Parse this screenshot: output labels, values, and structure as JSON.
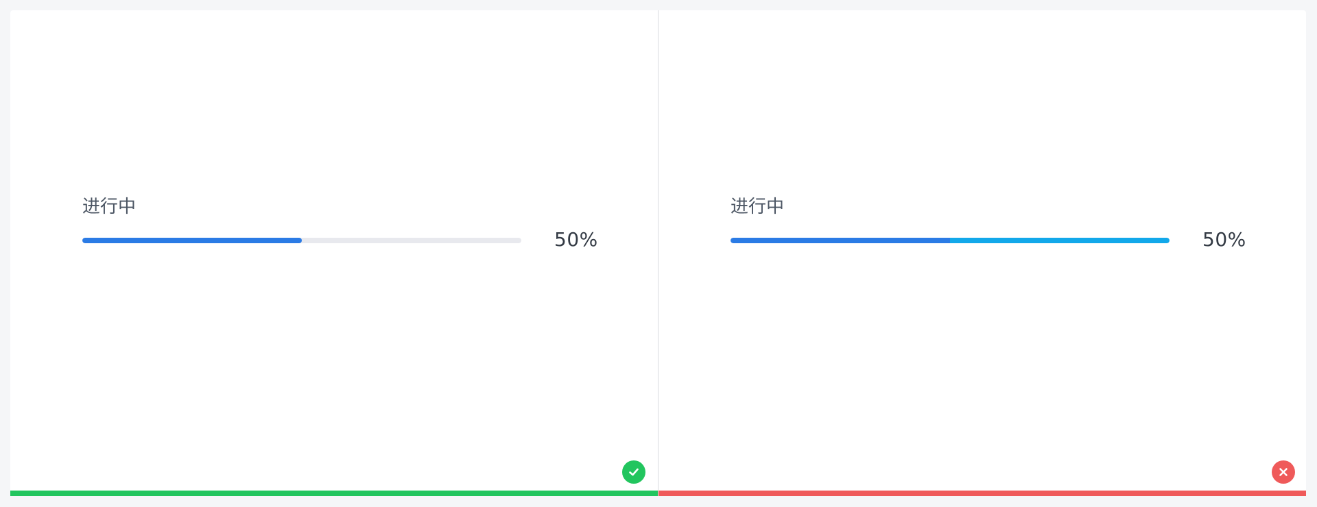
{
  "panels": [
    {
      "label": "进行中",
      "percent_text": "50%",
      "progress": 0.5,
      "bar_style": "solid",
      "status": "correct",
      "status_icon": "check-circle-icon",
      "colors": {
        "fill": "#2b7be5",
        "track": "#e8e9ee",
        "status": "#22c55e"
      }
    },
    {
      "label": "进行中",
      "percent_text": "50%",
      "progress": 0.5,
      "bar_style": "two-tone",
      "status": "incorrect",
      "status_icon": "x-circle-icon",
      "colors": {
        "fill": "#2b7be5",
        "remainder": "#12a8ea",
        "status": "#ef5a5a"
      }
    }
  ]
}
